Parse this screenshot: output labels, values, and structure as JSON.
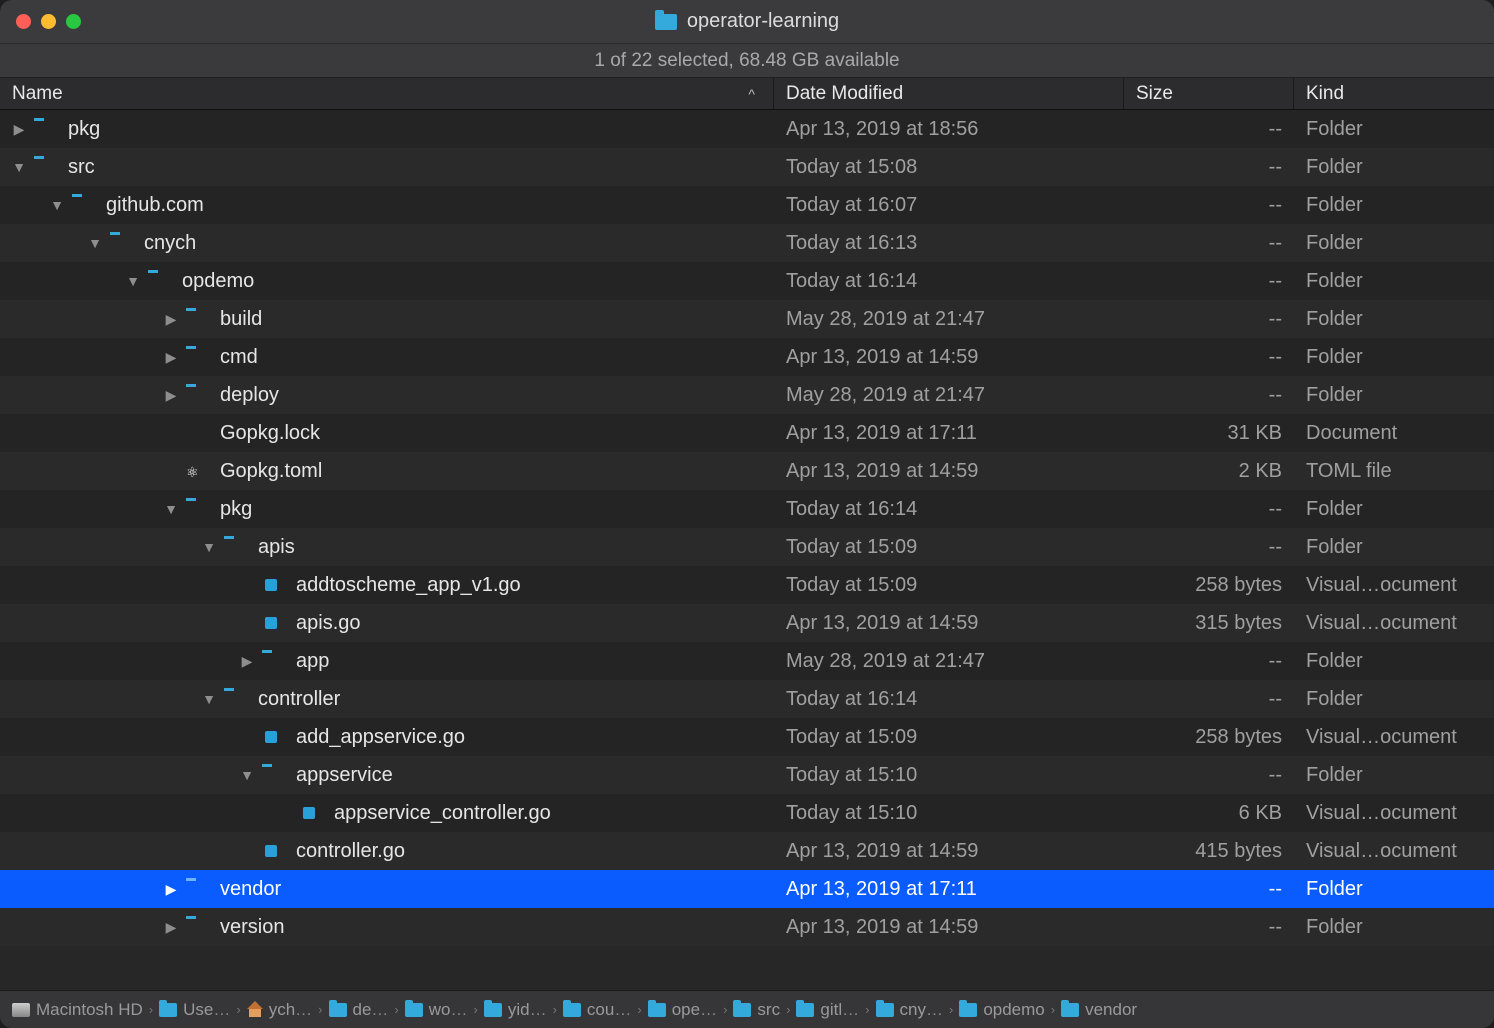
{
  "window": {
    "title": "operator-learning"
  },
  "status": "1 of 22 selected, 68.48 GB available",
  "columns": {
    "name": "Name",
    "date": "Date Modified",
    "size": "Size",
    "kind": "Kind",
    "sort_indicator": "^"
  },
  "rows": [
    {
      "name": "pkg",
      "indent": 0,
      "expanded": false,
      "hasChildren": true,
      "icon": "folder",
      "date": "Apr 13, 2019 at 18:56",
      "size": "--",
      "kind": "Folder",
      "selected": false
    },
    {
      "name": "src",
      "indent": 0,
      "expanded": true,
      "hasChildren": true,
      "icon": "folder",
      "date": "Today at 15:08",
      "size": "--",
      "kind": "Folder",
      "selected": false
    },
    {
      "name": "github.com",
      "indent": 1,
      "expanded": true,
      "hasChildren": true,
      "icon": "folder",
      "date": "Today at 16:07",
      "size": "--",
      "kind": "Folder",
      "selected": false
    },
    {
      "name": "cnych",
      "indent": 2,
      "expanded": true,
      "hasChildren": true,
      "icon": "folder",
      "date": "Today at 16:13",
      "size": "--",
      "kind": "Folder",
      "selected": false
    },
    {
      "name": "opdemo",
      "indent": 3,
      "expanded": true,
      "hasChildren": true,
      "icon": "folder",
      "date": "Today at 16:14",
      "size": "--",
      "kind": "Folder",
      "selected": false
    },
    {
      "name": "build",
      "indent": 4,
      "expanded": false,
      "hasChildren": true,
      "icon": "folder",
      "date": "May 28, 2019 at 21:47",
      "size": "--",
      "kind": "Folder",
      "selected": false
    },
    {
      "name": "cmd",
      "indent": 4,
      "expanded": false,
      "hasChildren": true,
      "icon": "folder",
      "date": "Apr 13, 2019 at 14:59",
      "size": "--",
      "kind": "Folder",
      "selected": false
    },
    {
      "name": "deploy",
      "indent": 4,
      "expanded": false,
      "hasChildren": true,
      "icon": "folder",
      "date": "May 28, 2019 at 21:47",
      "size": "--",
      "kind": "Folder",
      "selected": false
    },
    {
      "name": "Gopkg.lock",
      "indent": 4,
      "expanded": false,
      "hasChildren": false,
      "icon": "file",
      "date": "Apr 13, 2019 at 17:11",
      "size": "31 KB",
      "kind": "Document",
      "selected": false
    },
    {
      "name": "Gopkg.toml",
      "indent": 4,
      "expanded": false,
      "hasChildren": false,
      "icon": "toml",
      "date": "Apr 13, 2019 at 14:59",
      "size": "2 KB",
      "kind": "TOML file",
      "selected": false
    },
    {
      "name": "pkg",
      "indent": 4,
      "expanded": true,
      "hasChildren": true,
      "icon": "folder",
      "date": "Today at 16:14",
      "size": "--",
      "kind": "Folder",
      "selected": false
    },
    {
      "name": "apis",
      "indent": 5,
      "expanded": true,
      "hasChildren": true,
      "icon": "folder",
      "date": "Today at 15:09",
      "size": "--",
      "kind": "Folder",
      "selected": false
    },
    {
      "name": "addtoscheme_app_v1.go",
      "indent": 6,
      "expanded": false,
      "hasChildren": false,
      "icon": "go",
      "date": "Today at 15:09",
      "size": "258 bytes",
      "kind": "Visual…ocument",
      "selected": false
    },
    {
      "name": "apis.go",
      "indent": 6,
      "expanded": false,
      "hasChildren": false,
      "icon": "go",
      "date": "Apr 13, 2019 at 14:59",
      "size": "315 bytes",
      "kind": "Visual…ocument",
      "selected": false
    },
    {
      "name": "app",
      "indent": 6,
      "expanded": false,
      "hasChildren": true,
      "icon": "folder",
      "date": "May 28, 2019 at 21:47",
      "size": "--",
      "kind": "Folder",
      "selected": false
    },
    {
      "name": "controller",
      "indent": 5,
      "expanded": true,
      "hasChildren": true,
      "icon": "folder",
      "date": "Today at 16:14",
      "size": "--",
      "kind": "Folder",
      "selected": false
    },
    {
      "name": "add_appservice.go",
      "indent": 6,
      "expanded": false,
      "hasChildren": false,
      "icon": "go",
      "date": "Today at 15:09",
      "size": "258 bytes",
      "kind": "Visual…ocument",
      "selected": false
    },
    {
      "name": "appservice",
      "indent": 6,
      "expanded": true,
      "hasChildren": true,
      "icon": "folder",
      "date": "Today at 15:10",
      "size": "--",
      "kind": "Folder",
      "selected": false
    },
    {
      "name": "appservice_controller.go",
      "indent": 7,
      "expanded": false,
      "hasChildren": false,
      "icon": "go",
      "date": "Today at 15:10",
      "size": "6 KB",
      "kind": "Visual…ocument",
      "selected": false
    },
    {
      "name": "controller.go",
      "indent": 6,
      "expanded": false,
      "hasChildren": false,
      "icon": "go",
      "date": "Apr 13, 2019 at 14:59",
      "size": "415 bytes",
      "kind": "Visual…ocument",
      "selected": false
    },
    {
      "name": "vendor",
      "indent": 4,
      "expanded": false,
      "hasChildren": true,
      "icon": "folder",
      "date": "Apr 13, 2019 at 17:11",
      "size": "--",
      "kind": "Folder",
      "selected": true
    },
    {
      "name": "version",
      "indent": 4,
      "expanded": false,
      "hasChildren": true,
      "icon": "folder",
      "date": "Apr 13, 2019 at 14:59",
      "size": "--",
      "kind": "Folder",
      "selected": false
    }
  ],
  "pathbar": [
    {
      "label": "Macintosh HD",
      "icon": "disk",
      "trunc": false
    },
    {
      "label": "Use",
      "icon": "folder",
      "trunc": true
    },
    {
      "label": "ych",
      "icon": "home",
      "trunc": true
    },
    {
      "label": "de",
      "icon": "folder",
      "trunc": true
    },
    {
      "label": "wo",
      "icon": "folder",
      "trunc": true
    },
    {
      "label": "yid",
      "icon": "folder",
      "trunc": true
    },
    {
      "label": "cou",
      "icon": "folder",
      "trunc": true
    },
    {
      "label": "ope",
      "icon": "folder",
      "trunc": true
    },
    {
      "label": "src",
      "icon": "folder",
      "trunc": false
    },
    {
      "label": "gitl",
      "icon": "folder",
      "trunc": true
    },
    {
      "label": "cny",
      "icon": "folder",
      "trunc": true
    },
    {
      "label": "opdemo",
      "icon": "folder",
      "trunc": false
    },
    {
      "label": "vendor",
      "icon": "folder",
      "trunc": false
    }
  ]
}
